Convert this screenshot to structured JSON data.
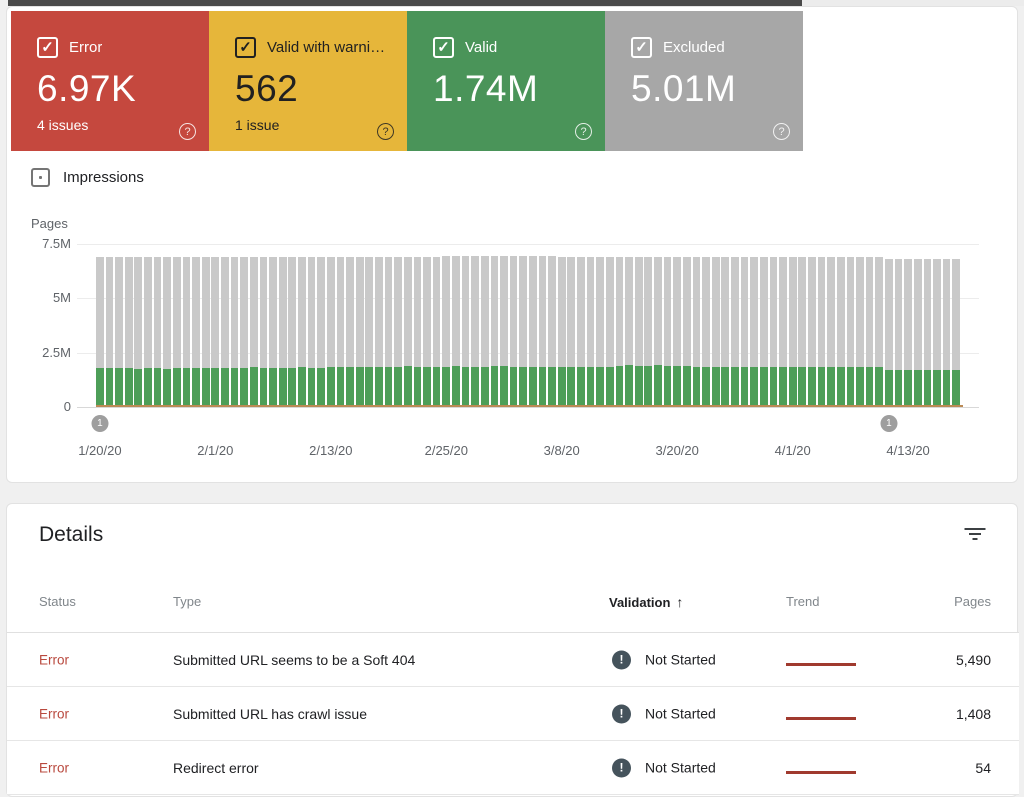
{
  "colors": {
    "error_bg": "#c5483e",
    "warning_bg": "#e6b63a",
    "valid_bg": "#4a9459",
    "excluded_bg": "#a7a7a7",
    "chart_valid": "#4d9e58",
    "chart_excluded": "#c9c9c9",
    "error_text": "#b9493e",
    "trend_line": "#a03a2e",
    "validation_icon_bg": "#45535c"
  },
  "status_cards": [
    {
      "id": "error",
      "label": "Error",
      "value": "6.97K",
      "sub": "4 issues",
      "bg": "#c5483e",
      "fg": "#ffffff",
      "checked": true
    },
    {
      "id": "valid-with-warnings",
      "label": "Valid with warni…",
      "value": "562",
      "sub": "1 issue",
      "bg": "#e6b63a",
      "fg": "#212121",
      "checked": true
    },
    {
      "id": "valid",
      "label": "Valid",
      "value": "1.74M",
      "sub": "",
      "bg": "#4a9459",
      "fg": "#ffffff",
      "checked": true
    },
    {
      "id": "excluded",
      "label": "Excluded",
      "value": "5.01M",
      "sub": "",
      "bg": "#a7a7a7",
      "fg": "#ffffff",
      "checked": true
    }
  ],
  "impressions": {
    "label": "Impressions",
    "checked": false
  },
  "chart_data": {
    "type": "bar",
    "stacked": true,
    "ylabel": "Pages",
    "y_ticks": [
      "7.5M",
      "5M",
      "2.5M",
      "0"
    ],
    "ylim_millions": [
      0,
      7.5
    ],
    "x_tick_labels": [
      "1/20/20",
      "2/1/20",
      "2/13/20",
      "2/25/20",
      "3/8/20",
      "3/20/20",
      "4/1/20",
      "4/13/20"
    ],
    "x_tick_every_days": 12,
    "grid": true,
    "series": [
      {
        "name": "Valid",
        "color": "#4d9e58",
        "unit": "millions",
        "values": [
          1.8,
          1.78,
          1.8,
          1.79,
          1.77,
          1.8,
          1.78,
          1.76,
          1.78,
          1.8,
          1.79,
          1.78,
          1.79,
          1.8,
          1.78,
          1.8,
          1.82,
          1.8,
          1.79,
          1.81,
          1.8,
          1.82,
          1.81,
          1.8,
          1.84,
          1.85,
          1.84,
          1.86,
          1.85,
          1.84,
          1.86,
          1.85,
          1.87,
          1.86,
          1.85,
          1.86,
          1.86,
          1.87,
          1.86,
          1.85,
          1.86,
          1.87,
          1.88,
          1.86,
          1.85,
          1.86,
          1.85,
          1.86,
          1.85,
          1.86,
          1.84,
          1.85,
          1.86,
          1.85,
          1.9,
          1.92,
          1.91,
          1.9,
          1.92,
          1.91,
          1.9,
          1.88,
          1.86,
          1.85,
          1.86,
          1.85,
          1.84,
          1.85,
          1.86,
          1.85,
          1.84,
          1.85,
          1.85,
          1.84,
          1.85,
          1.84,
          1.85,
          1.84,
          1.85,
          1.84,
          1.83,
          1.82,
          1.72,
          1.72,
          1.71,
          1.72,
          1.71,
          1.72,
          1.71,
          1.72
        ]
      },
      {
        "name": "Excluded",
        "color": "#c9c9c9",
        "unit": "millions",
        "values": [
          5.1,
          5.12,
          5.1,
          5.11,
          5.13,
          5.1,
          5.12,
          5.14,
          5.12,
          5.1,
          5.11,
          5.12,
          5.13,
          5.12,
          5.14,
          5.12,
          5.1,
          5.12,
          5.13,
          5.11,
          5.12,
          5.1,
          5.11,
          5.12,
          5.08,
          5.07,
          5.08,
          5.06,
          5.07,
          5.08,
          5.06,
          5.07,
          5.05,
          5.06,
          5.07,
          5.06,
          5.07,
          5.06,
          5.07,
          5.08,
          5.07,
          5.06,
          5.05,
          5.07,
          5.08,
          5.07,
          5.08,
          5.07,
          5.07,
          5.06,
          5.08,
          5.07,
          5.06,
          5.07,
          5.02,
          5.0,
          5.01,
          5.02,
          5.0,
          5.01,
          5.01,
          5.03,
          5.05,
          5.06,
          5.05,
          5.06,
          5.07,
          5.06,
          5.05,
          5.06,
          5.07,
          5.06,
          5.05,
          5.06,
          5.05,
          5.06,
          5.05,
          5.06,
          5.05,
          5.06,
          5.07,
          5.08,
          5.08,
          5.08,
          5.09,
          5.08,
          5.09,
          5.08,
          5.09,
          5.08
        ]
      }
    ],
    "annotations": [
      {
        "label": "1",
        "day_index": 0
      },
      {
        "label": "1",
        "day_index": 82
      }
    ]
  },
  "details": {
    "title": "Details",
    "columns": [
      "Status",
      "Type",
      "Validation",
      "Trend",
      "Pages"
    ],
    "sort_column": "Validation",
    "sort_indicator": "↑",
    "rows": [
      {
        "status": "Error",
        "type": "Submitted URL seems to be a Soft 404",
        "validation": "Not Started",
        "pages": "5,490"
      },
      {
        "status": "Error",
        "type": "Submitted URL has crawl issue",
        "validation": "Not Started",
        "pages": "1,408"
      },
      {
        "status": "Error",
        "type": "Redirect error",
        "validation": "Not Started",
        "pages": "54"
      }
    ]
  }
}
